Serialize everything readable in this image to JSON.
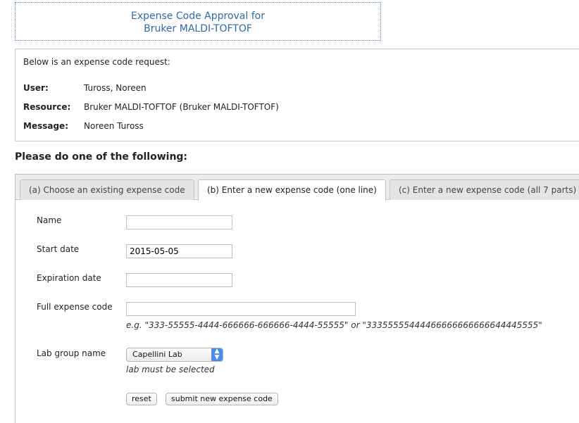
{
  "title": {
    "line1": "Expense Code Approval for",
    "line2": "Bruker MALDI-TOFTOF"
  },
  "request": {
    "intro": "Below is an expense code request:",
    "user_label": "User:",
    "user_value": "Tuross, Noreen",
    "resource_label": "Resource:",
    "resource_value": "Bruker MALDI-TOFTOF (Bruker MALDI-TOFTOF)",
    "message_label": "Message:",
    "message_value": "Noreen Tuross"
  },
  "section_heading": "Please do one of the following:",
  "tabs": [
    {
      "label": "(a) Choose an existing expense code",
      "active": false
    },
    {
      "label": "(b) Enter a new expense code (one line)",
      "active": true
    },
    {
      "label": "(c) Enter a new expense code (all 7 parts)",
      "active": false
    }
  ],
  "form": {
    "name_label": "Name",
    "name_value": "",
    "start_date_label": "Start date",
    "start_date_value": "2015-05-05",
    "expiration_label": "Expiration date",
    "expiration_value": "",
    "full_code_label": "Full expense code",
    "full_code_value": "",
    "full_code_hint": "e.g. \"333-55555-4444-666666-666666-4444-55555\" or \"33355555444466666666666644445555\"",
    "lab_group_label": "Lab group name",
    "lab_group_selected": "Capellini Lab",
    "lab_group_hint": "lab must be selected",
    "reset_label": "reset",
    "submit_label": "submit new expense code"
  },
  "colors": {
    "title_text": "#2f6aa3",
    "select_arrow": "#4a8ce6"
  }
}
